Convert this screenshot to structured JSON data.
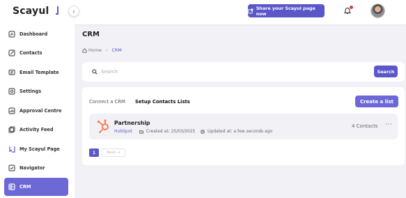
{
  "app": {
    "logo_text": "Scayul"
  },
  "sidebar": {
    "items": [
      {
        "label": "Dashboard",
        "icon": "dashboard-icon"
      },
      {
        "label": "Contacts",
        "icon": "contacts-icon"
      },
      {
        "label": "Email Template",
        "icon": "email-template-icon"
      },
      {
        "label": "Settings",
        "icon": "settings-icon"
      },
      {
        "label": "Approval Centre",
        "icon": "approval-icon"
      },
      {
        "label": "Activity Feed",
        "icon": "activity-feed-icon"
      },
      {
        "label": "My Scayul Page",
        "icon": "scayul-page-icon"
      },
      {
        "label": "Navigator",
        "icon": "navigator-icon"
      },
      {
        "label": "CRM",
        "icon": "crm-icon",
        "active": true
      }
    ]
  },
  "header": {
    "share_label": "Share your Scayul page now",
    "notification_icon": "bell-icon"
  },
  "main": {
    "title": "CRM",
    "breadcrumb": {
      "home": "Home",
      "current": "CRM"
    },
    "search": {
      "placeholder": "Search",
      "button_label": "Search"
    },
    "tabs": [
      {
        "label": "Connect a CRM",
        "active": false
      },
      {
        "label": "Setup Contacts Lists",
        "active": true
      }
    ],
    "create_label": "Create a list",
    "lists": [
      {
        "name": "Partnership",
        "source": "HubSpot",
        "created": "Created at: 25/03/2025",
        "updated": "Updated at: a few seconds ago",
        "count": "4 Contacts",
        "more": "···"
      }
    ],
    "pagination": {
      "current_page": "1",
      "next_label": "Next →"
    }
  },
  "colors": {
    "accent": "#5b57c9",
    "accent_light": "#6c68d6",
    "hubspot": "#ff7a59",
    "badge": "#e53935"
  }
}
